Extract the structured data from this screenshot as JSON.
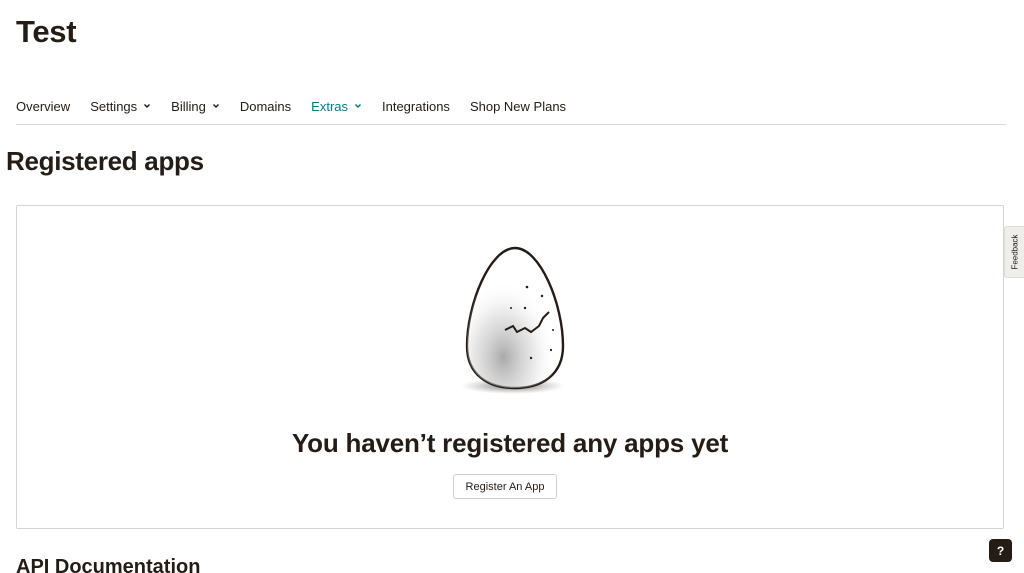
{
  "account": {
    "title": "Test"
  },
  "tabs": [
    {
      "label": "Overview",
      "has_dropdown": false,
      "active": false
    },
    {
      "label": "Settings",
      "has_dropdown": true,
      "active": false
    },
    {
      "label": "Billing",
      "has_dropdown": true,
      "active": false
    },
    {
      "label": "Domains",
      "has_dropdown": false,
      "active": false
    },
    {
      "label": "Extras",
      "has_dropdown": true,
      "active": true
    },
    {
      "label": "Integrations",
      "has_dropdown": false,
      "active": false
    },
    {
      "label": "Shop New Plans",
      "has_dropdown": false,
      "active": false
    }
  ],
  "section": {
    "title": "Registered apps"
  },
  "empty_state": {
    "illustration": "cracked-egg-icon",
    "title": "You haven’t registered any apps yet",
    "button_label": "Register An App"
  },
  "api_docs": {
    "title": "API Documentation"
  },
  "feedback": {
    "label": "Feedback"
  },
  "help": {
    "label": "?"
  },
  "colors": {
    "text": "#241c15",
    "accent": "#007c89",
    "border": "#d4d4d4",
    "help_bg": "#241c15"
  }
}
